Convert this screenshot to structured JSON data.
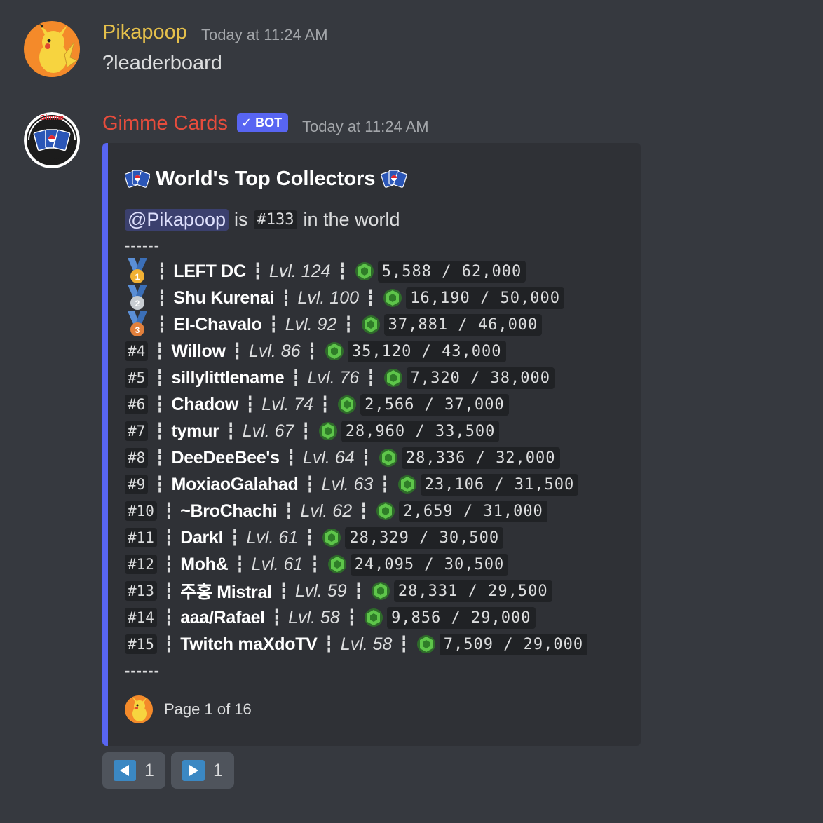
{
  "msg1": {
    "username": "Pikapoop",
    "username_color": "#e5c04b",
    "timestamp": "Today at 11:24 AM",
    "text": "?leaderboard"
  },
  "msg2": {
    "username": "Gimme Cards",
    "username_color": "#e74c3c",
    "bot_label": "BOT",
    "timestamp": "Today at 11:24 AM",
    "avatar_text_top": "Gimme",
    "avatar_text_bottom": "Cards"
  },
  "embed": {
    "title": "World's Top Collectors",
    "mention": "@Pikapoop",
    "is_text": "is",
    "rank_code": "#133",
    "world_text": "in the world",
    "dashes": "------",
    "rows": [
      {
        "rank": "1",
        "medal": "gold",
        "name": "LEFT DC",
        "level": "Lvl. 124",
        "progress": "5,588 / 62,000"
      },
      {
        "rank": "2",
        "medal": "silver",
        "name": "Shu Kurenai",
        "level": "Lvl. 100",
        "progress": "16,190 / 50,000"
      },
      {
        "rank": "3",
        "medal": "bronze",
        "name": "El-Chavalo",
        "level": "Lvl. 92",
        "progress": "37,881 / 46,000"
      },
      {
        "rank": "#4",
        "medal": "",
        "name": "Willow",
        "level": "Lvl. 86",
        "progress": "35,120 / 43,000"
      },
      {
        "rank": "#5",
        "medal": "",
        "name": "sillylittlename",
        "level": "Lvl. 76",
        "progress": "7,320 / 38,000"
      },
      {
        "rank": "#6",
        "medal": "",
        "name": "Chadow",
        "level": "Lvl. 74",
        "progress": "2,566 / 37,000"
      },
      {
        "rank": "#7",
        "medal": "",
        "name": "tymur",
        "level": "Lvl. 67",
        "progress": "28,960 / 33,500"
      },
      {
        "rank": "#8",
        "medal": "",
        "name": "DeeDeeBee's",
        "level": "Lvl. 64",
        "progress": "28,336 / 32,000"
      },
      {
        "rank": "#9",
        "medal": "",
        "name": "MoxiaoGalahad",
        "level": "Lvl. 63",
        "progress": "23,106 / 31,500"
      },
      {
        "rank": "#10",
        "medal": "",
        "name": "~BroChachi",
        "level": "Lvl. 62",
        "progress": "2,659 / 31,000"
      },
      {
        "rank": "#11",
        "medal": "",
        "name": "Darkl",
        "level": "Lvl. 61",
        "progress": "28,329 / 30,500"
      },
      {
        "rank": "#12",
        "medal": "",
        "name": "Moh&",
        "level": "Lvl. 61",
        "progress": "24,095 / 30,500"
      },
      {
        "rank": "#13",
        "medal": "",
        "name": "주홍 Mistral",
        "level": "Lvl. 59",
        "progress": "28,331 / 29,500"
      },
      {
        "rank": "#14",
        "medal": "",
        "name": "aaa/Rafael",
        "level": "Lvl. 58",
        "progress": "9,856 / 29,000"
      },
      {
        "rank": "#15",
        "medal": "",
        "name": "Twitch maXdoTV",
        "level": "Lvl. 58",
        "progress": "7,509 / 29,000"
      }
    ],
    "footer_text": "Page 1 of 16",
    "accent_color": "#5865f2"
  },
  "buttons": {
    "prev_count": "1",
    "next_count": "1"
  },
  "icons": {
    "separator": "┇",
    "gem": "green-gem-icon",
    "cards": "pokemon-cards-icon"
  }
}
